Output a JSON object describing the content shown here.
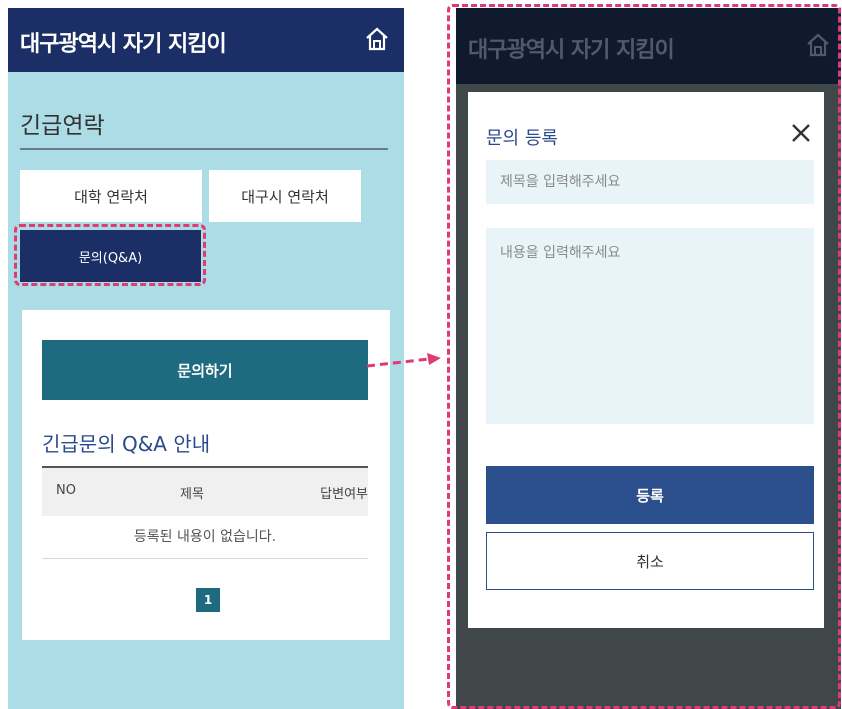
{
  "left": {
    "app_title": "대구광역시 자기 지킴이",
    "section_title": "긴급연락",
    "tabs": [
      {
        "label": "대학 연락처"
      },
      {
        "label": "대구시 연락처"
      },
      {
        "label": "문의(Q&A)"
      }
    ],
    "ask_button": "문의하기",
    "qa_title": "긴급문의 Q&A 안내",
    "table": {
      "columns": [
        "NO",
        "제목",
        "답변여부"
      ],
      "empty_message": "등록된 내용이 없습니다."
    },
    "pagination": {
      "current_page": "1"
    }
  },
  "right": {
    "app_title": "대구광역시 자기 지킴이",
    "modal": {
      "title": "문의 등록",
      "title_placeholder": "제목을 입력해주세요",
      "content_placeholder": "내용을 입력해주세요",
      "submit_label": "등록",
      "cancel_label": "취소"
    }
  },
  "colors": {
    "header_navy": "#1b2f66",
    "background_lightblue": "#acdde6",
    "accent_teal": "#1e6b80",
    "highlight_dash": "#e03a75",
    "button_blue": "#2b4f8c"
  }
}
